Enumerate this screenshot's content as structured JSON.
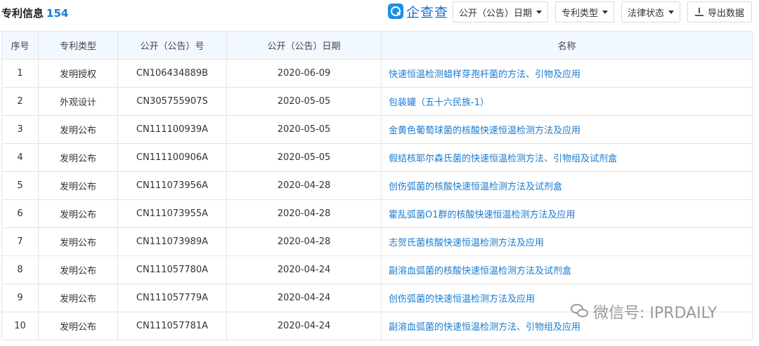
{
  "header": {
    "title": "专利信息",
    "count": "154",
    "logo_text": "企查查",
    "buttons": {
      "date_filter": "公开（公告）日期",
      "type_filter": "专利类型",
      "status_filter": "法律状态",
      "export": "导出数据"
    }
  },
  "table": {
    "columns": [
      "序号",
      "专利类型",
      "公开（公告）号",
      "公开（公告）日期",
      "名称"
    ],
    "rows": [
      {
        "no": "1",
        "type": "发明授权",
        "number": "CN106434889B",
        "date": "2020-06-09",
        "name": "快速恒温检测蜡样芽孢杆菌的方法、引物及应用"
      },
      {
        "no": "2",
        "type": "外观设计",
        "number": "CN305755907S",
        "date": "2020-05-05",
        "name": "包装罐（五十六民族-1）"
      },
      {
        "no": "3",
        "type": "发明公布",
        "number": "CN111100939A",
        "date": "2020-05-05",
        "name": "金黄色葡萄球菌的核酸快速恒温检测方法及应用"
      },
      {
        "no": "4",
        "type": "发明公布",
        "number": "CN111100906A",
        "date": "2020-05-05",
        "name": "假结核耶尔森氏菌的快速恒温检测方法、引物组及试剂盒"
      },
      {
        "no": "5",
        "type": "发明公布",
        "number": "CN111073956A",
        "date": "2020-04-28",
        "name": "创伤弧菌的核酸快速恒温检测方法及试剂盒"
      },
      {
        "no": "6",
        "type": "发明公布",
        "number": "CN111073955A",
        "date": "2020-04-28",
        "name": "霍乱弧菌O1群的核酸快速恒温检测方法及应用"
      },
      {
        "no": "7",
        "type": "发明公布",
        "number": "CN111073989A",
        "date": "2020-04-28",
        "name": "志贺氏菌核酸快速恒温检测方法及应用"
      },
      {
        "no": "8",
        "type": "发明公布",
        "number": "CN111057780A",
        "date": "2020-04-24",
        "name": "副溶血弧菌的核酸快速恒温检测方法及试剂盒"
      },
      {
        "no": "9",
        "type": "发明公布",
        "number": "CN111057779A",
        "date": "2020-04-24",
        "name": "创伤弧菌的快速恒温检测方法及应用"
      },
      {
        "no": "10",
        "type": "发明公布",
        "number": "CN111057781A",
        "date": "2020-04-24",
        "name": "副溶血弧菌的快速恒温检测方法、引物组及应用"
      }
    ]
  },
  "watermark": {
    "text": "微信号: IPRDAILY",
    "icon": "wechat-icon"
  },
  "colors": {
    "link": "#1a7bd0",
    "header_bg": "#f2f8ff",
    "logo": "#1a8fe6"
  }
}
